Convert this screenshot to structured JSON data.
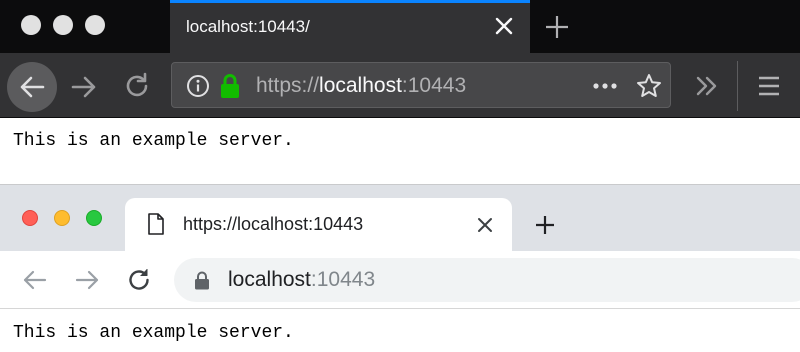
{
  "firefox": {
    "tab": {
      "title": "localhost:10443/"
    },
    "url": {
      "scheme": "https://",
      "host": "localhost",
      "port": ":10443"
    },
    "page": {
      "text": "This is an example server."
    }
  },
  "chrome": {
    "tab": {
      "title": "https://localhost:10443"
    },
    "url": {
      "host": "localhost",
      "port": ":10443"
    },
    "page": {
      "text": "This is an example server."
    }
  },
  "icons": [
    "window-dot",
    "close-icon",
    "plus-icon",
    "back-arrow-icon",
    "forward-arrow-icon",
    "reload-icon",
    "info-icon",
    "lock-icon",
    "more-icon",
    "star-icon",
    "overflow-icon",
    "menu-icon",
    "page-icon"
  ],
  "colors": {
    "ff_tabbar": "#0c0c0d",
    "ff_toolbar": "#323234",
    "ff_accent": "#0a84ff",
    "ff_lock_green": "#12bc00",
    "cr_tabbar": "#dee1e6",
    "cr_close_red": "#ff5f57",
    "cr_min_yellow": "#febc2e",
    "cr_max_green": "#28c840"
  }
}
